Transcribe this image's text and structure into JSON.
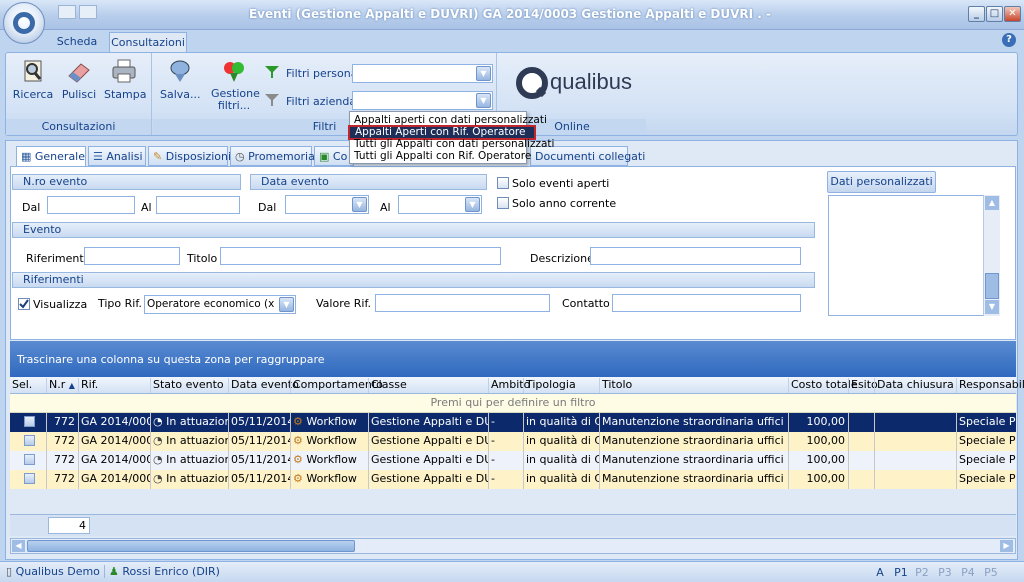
{
  "window": {
    "title": "Eventi (Gestione Appalti e DUVRI)  GA 2014/0003 Gestione Appalti e DUVRI . -",
    "minimize": "_",
    "maximize": "□",
    "close": "✕"
  },
  "ribbon_tabs": [
    "Scheda",
    "Consultazioni"
  ],
  "ribbon": {
    "consultazioni": {
      "ricerca": "Ricerca",
      "pulisci": "Pulisci",
      "stampa": "Stampa",
      "group": "Consultazioni"
    },
    "filtri": {
      "salva": "Salva...",
      "gestione": "Gestione filtri...",
      "personali": "Filtri personali",
      "aziendali": "Filtri aziendali",
      "group": "Filtri"
    },
    "online": {
      "logo": "qualibus",
      "group": "Online"
    }
  },
  "dropdown_menu": [
    "Appalti aperti con dati personalizzati",
    "Appalti Aperti con Rif. Operatore",
    "Tutti gli Appalti con dati personalizzati",
    "Tutti gli Appalti con Rif. Operatore"
  ],
  "inner_tabs": [
    "Generale",
    "Analisi",
    "Disposizioni",
    "Promemoria",
    "Co",
    "Documenti collegati"
  ],
  "form": {
    "nro_evento": "N.ro evento",
    "dal": "Dal",
    "al": "Al",
    "data_evento": "Data evento",
    "solo_aperti": "Solo eventi aperti",
    "solo_anno": "Solo anno corrente",
    "evento": "Evento",
    "riferimento": "Riferimento",
    "titolo": "Titolo",
    "descrizione": "Descrizione",
    "riferimenti": "Riferimenti",
    "visualizza": "Visualizza",
    "tipo_rif": "Tipo Rif.",
    "tipo_rif_value": "Operatore economico (x appa",
    "valore_rif": "Valore Rif.",
    "contatto": "Contatto",
    "dati_pers": "Dati personalizzati"
  },
  "grid": {
    "group_hint": "Trascinare una colonna su questa zona per raggruppare",
    "filter_hint": "Premi qui per definire un filtro",
    "columns": [
      "Sel.",
      "N.r",
      "Rif.",
      "Stato evento",
      "Data evento",
      "Comportamento",
      "Classe",
      "Ambito",
      "Tipologia",
      "Titolo",
      "Costo totale",
      "Esito",
      "Data chiusura",
      "Responsabil"
    ],
    "rows": [
      {
        "nr": "772",
        "rif": "GA 2014/0003",
        "stato": "In attuazion",
        "data": "05/11/2014",
        "comp": "Workflow",
        "classe": "Gestione Appalti e DUVRI",
        "ambito": "-",
        "tipologia": "in qualità di Com",
        "titolo": "Manutenzione straordinaria uffici",
        "costo": "100,00",
        "resp": "Speciale Pie"
      },
      {
        "nr": "772",
        "rif": "GA 2014/0003",
        "stato": "In attuazion",
        "data": "05/11/2014",
        "comp": "Workflow",
        "classe": "Gestione Appalti e DUVRI",
        "ambito": "-",
        "tipologia": "in qualità di Com",
        "titolo": "Manutenzione straordinaria uffici",
        "costo": "100,00",
        "resp": "Speciale Pie"
      },
      {
        "nr": "772",
        "rif": "GA 2014/0003",
        "stato": "In attuazion",
        "data": "05/11/2014",
        "comp": "Workflow",
        "classe": "Gestione Appalti e DUVRI",
        "ambito": "-",
        "tipologia": "in qualità di Com",
        "titolo": "Manutenzione straordinaria uffici",
        "costo": "100,00",
        "resp": "Speciale Pie"
      },
      {
        "nr": "772",
        "rif": "GA 2014/0003",
        "stato": "In attuazion",
        "data": "05/11/2014",
        "comp": "Workflow",
        "classe": "Gestione Appalti e DUVRI",
        "ambito": "-",
        "tipologia": "in qualità di Com",
        "titolo": "Manutenzione straordinaria uffici",
        "costo": "100,00",
        "resp": "Speciale Pie"
      }
    ],
    "count": "4"
  },
  "status": {
    "app": "Qualibus Demo",
    "user": "Rossi Enrico (DIR)",
    "pages": [
      "A",
      "P1",
      "P2",
      "P3",
      "P4",
      "P5"
    ]
  }
}
